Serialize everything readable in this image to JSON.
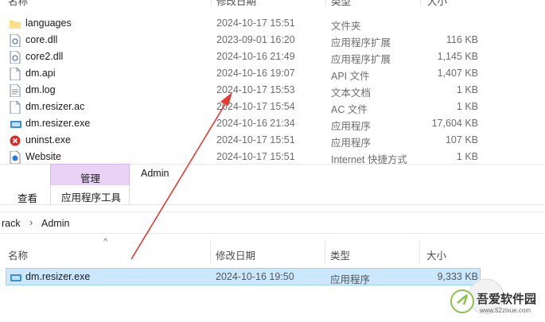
{
  "top_list": {
    "header": {
      "name": "名称",
      "date": "修改日期",
      "type": "类型",
      "size": "大小"
    },
    "rows": [
      {
        "icon": "folder-icon",
        "name": "languages",
        "date": "2024-10-17 15:51",
        "type": "文件夹",
        "size": ""
      },
      {
        "icon": "dll-file-icon",
        "name": "core.dll",
        "date": "2023-09-01 16:20",
        "type": "应用程序扩展",
        "size": "116 KB"
      },
      {
        "icon": "dll-file-icon",
        "name": "core2.dll",
        "date": "2024-10-16 21:49",
        "type": "应用程序扩展",
        "size": "1,145 KB"
      },
      {
        "icon": "file-icon",
        "name": "dm.api",
        "date": "2024-10-16 19:07",
        "type": "API 文件",
        "size": "1,407 KB"
      },
      {
        "icon": "text-file-icon",
        "name": "dm.log",
        "date": "2024-10-17 15:53",
        "type": "文本文档",
        "size": "1 KB"
      },
      {
        "icon": "file-icon",
        "name": "dm.resizer.ac",
        "date": "2024-10-17 15:54",
        "type": "AC 文件",
        "size": "1 KB"
      },
      {
        "icon": "app-exe-icon",
        "name": "dm.resizer.exe",
        "date": "2024-10-16 21:34",
        "type": "应用程序",
        "size": "17,604 KB"
      },
      {
        "icon": "uninstall-icon",
        "name": "uninst.exe",
        "date": "2024-10-17 15:51",
        "type": "应用程序",
        "size": "107 KB"
      },
      {
        "icon": "internet-shortcut-icon",
        "name": "Website",
        "date": "2024-10-17 15:51",
        "type": "Internet 快捷方式",
        "size": "1 KB"
      }
    ]
  },
  "ribbon": {
    "context_tab": "管理",
    "window_title": "Admin",
    "view_tab": "查看",
    "tools_tab": "应用程序工具"
  },
  "breadcrumb": {
    "parent": "rack",
    "separator": "›",
    "current": "Admin"
  },
  "bottom_list": {
    "sort_indicator": "^",
    "header": {
      "name": "名称",
      "date": "修改日期",
      "type": "类型",
      "size": "大小"
    },
    "rows": [
      {
        "icon": "app-exe-icon",
        "name": "dm.resizer.exe",
        "date": "2024-10-16 19:50",
        "type": "应用程序",
        "size": "9,333 KB",
        "selected": true
      }
    ]
  },
  "watermark": {
    "brand": "吾爱软件园",
    "url": "www.52zixue.com"
  },
  "colors": {
    "selection": "#cce8ff",
    "context_tab": "#e9d2f5",
    "arrow": "#e53935"
  }
}
